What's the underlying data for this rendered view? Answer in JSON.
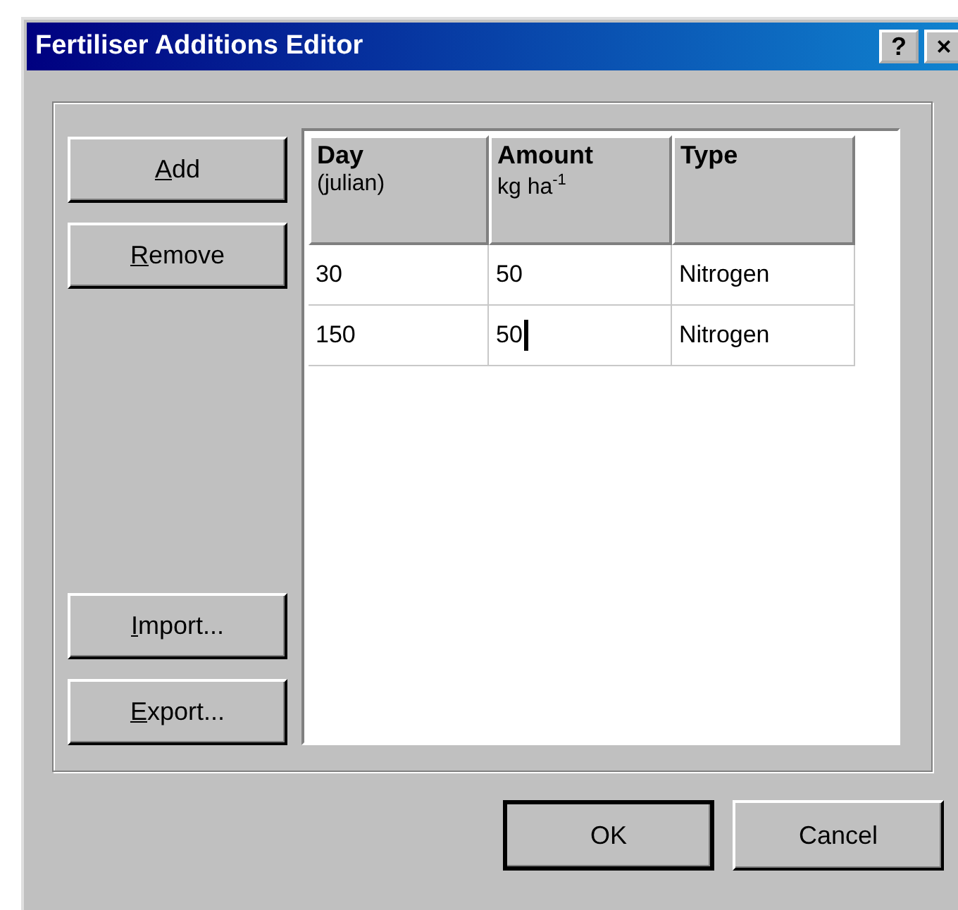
{
  "window": {
    "title": "Fertiliser Additions Editor",
    "title_buttons": [
      "?",
      "×"
    ]
  },
  "side_buttons": {
    "top": [
      {
        "label": "Add",
        "mnemonic": true
      },
      {
        "label": "Remove",
        "mnemonic": true
      }
    ],
    "bottom": [
      {
        "label": "Import...",
        "mnemonic": true
      },
      {
        "label": "Export...",
        "mnemonic": true
      }
    ]
  },
  "table": {
    "columns": [
      {
        "title": "Day",
        "subtitle": "(julian)"
      },
      {
        "title": "Amount",
        "subtitle": "kg ha$^{-1}$"
      },
      {
        "title": "Type"
      }
    ],
    "rows": [
      {
        "cells": [
          {
            "text": "30",
            "editing": false
          },
          {
            "text": "50",
            "editing": false
          },
          {
            "text": "Nitrogen",
            "editing": false
          }
        ]
      },
      {
        "cells": [
          {
            "text": "150",
            "editing": false
          },
          {
            "text": "50",
            "editing": true
          },
          {
            "text": "Nitrogen",
            "editing": false
          }
        ]
      }
    ]
  },
  "footer_buttons": [
    {
      "label": "OK",
      "default": true
    },
    {
      "label": "Cancel",
      "default": false
    }
  ]
}
